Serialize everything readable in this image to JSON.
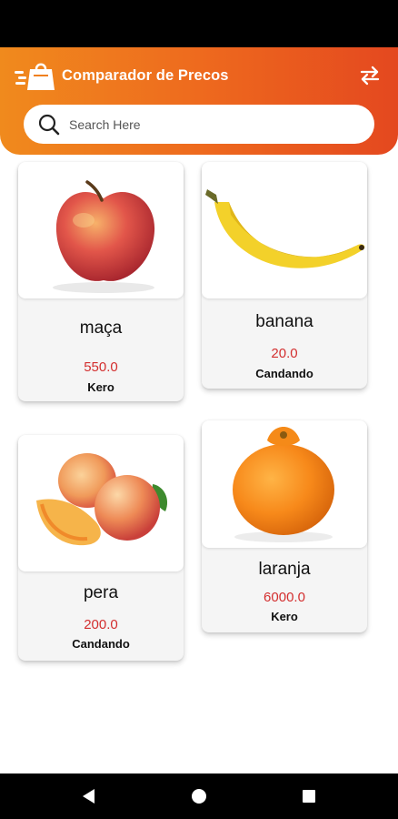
{
  "header": {
    "title": "Comparador de Precos",
    "accent_start": "#f08a1d",
    "accent_end": "#e4481f",
    "logo_icon": "shopping-bag-icon",
    "swap_icon": "swap-arrows-icon"
  },
  "search": {
    "placeholder": "Search Here",
    "value": ""
  },
  "products": [
    {
      "name": "maça",
      "price": "550.0",
      "store": "Kero",
      "image": "apple"
    },
    {
      "name": "banana",
      "price": "20.0",
      "store": "Candando",
      "image": "banana"
    },
    {
      "name": "pera",
      "price": "200.0",
      "store": "Candando",
      "image": "peach"
    },
    {
      "name": "laranja",
      "price": "6000.0",
      "store": "Kero",
      "image": "orange"
    }
  ],
  "price_color": "#d32f2f",
  "navigation": {
    "back_icon": "back-triangle-icon",
    "home_icon": "home-circle-icon",
    "recents_icon": "recents-square-icon"
  }
}
